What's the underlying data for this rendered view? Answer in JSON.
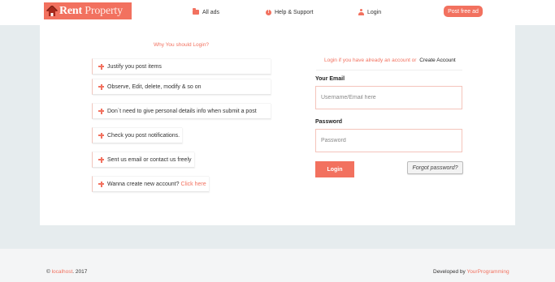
{
  "brand": {
    "logo_bold": "Rent",
    "logo_rest": "Property",
    "accent_color": "#f2715f"
  },
  "nav": {
    "all_ads": "All ads",
    "help_support": "Help & Support",
    "login": "Login",
    "post_free_ad": "Post free ad",
    "icons": [
      "folder-open-icon",
      "info-circle-icon",
      "user-icon"
    ]
  },
  "benefits": {
    "title": "Why You should Login?",
    "items": [
      "Justify you post items",
      "Observe, Edit, delete, modify & so on",
      "Don`t need to give personal details info when submit a post",
      "Check you post notifications.",
      "Sent us email or contact us freely",
      "Wanna create new account?"
    ],
    "click_here": "Click here"
  },
  "login_form": {
    "hint": "Login if you have already an account or",
    "create_account": "Create Account",
    "email_label": "Your Email",
    "email_placeholder": "Username/Email here",
    "password_label": "Password",
    "password_placeholder": "Password",
    "login_button": "Login",
    "forgot_button": "Forgot password?"
  },
  "footer": {
    "copyright_symbol": "©",
    "site": "localhost",
    "year": ". 2017",
    "developed_by": "Developed by",
    "developer": "YourProgramming"
  }
}
